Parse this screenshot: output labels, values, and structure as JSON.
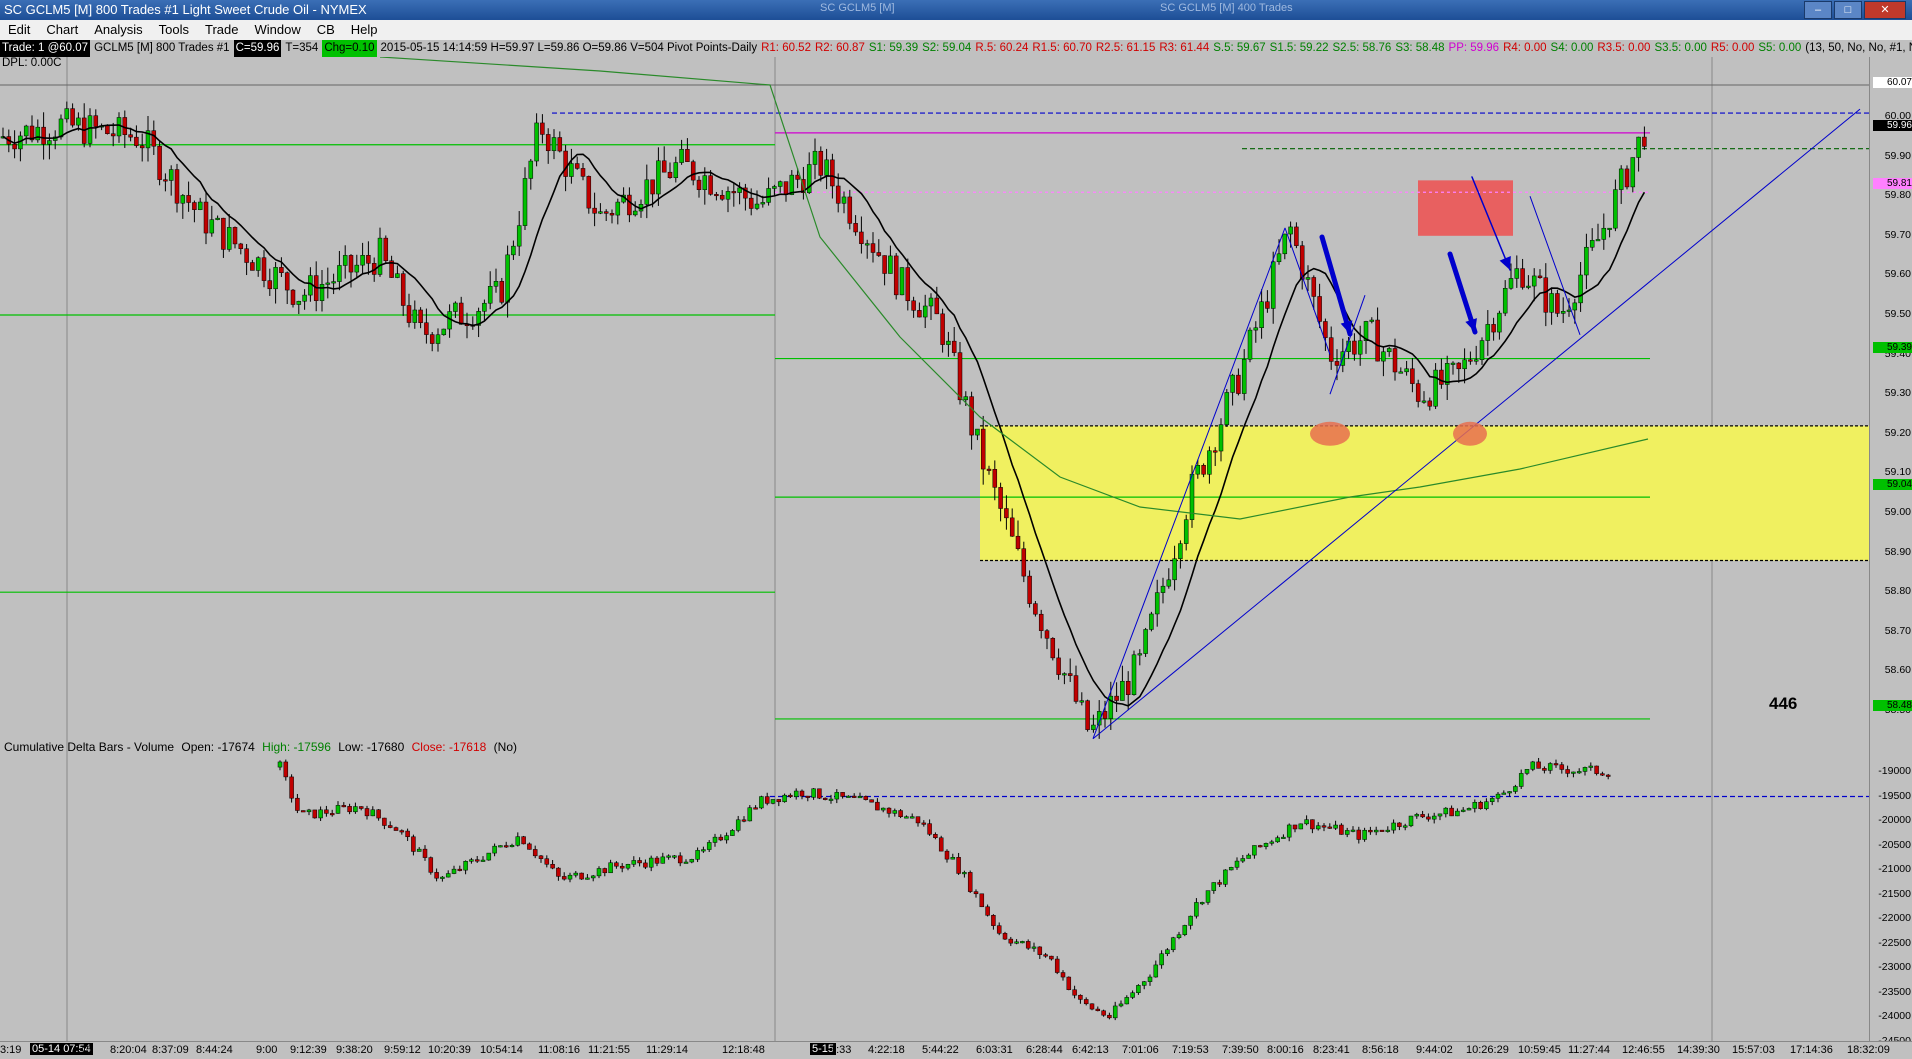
{
  "window": {
    "title": "SC GCLM5 [M]  800 Trades  #1  Light Sweet Crude Oil - NYMEX",
    "ghost_tabs": [
      "SC GCLM5 [M]",
      "SC GCLM5 [M] 400 Trades"
    ]
  },
  "menu": [
    "Edit",
    "Chart",
    "Analysis",
    "Tools",
    "Trade",
    "Window",
    "CB",
    "Help"
  ],
  "infobar": {
    "trade": "Trade: 1 @60.07",
    "symbol": "GCLM5 [M]  800 Trades  #1",
    "close": "C=59.96",
    "ticks": "T=354",
    "change": "Chg=0.10",
    "stats": "2015-05-15 14:14:59 H=59.97 L=59.86 O=59.86 V=504 Pivot Points-Daily",
    "pivots": [
      {
        "text": "R1: 60.52",
        "color": "red"
      },
      {
        "text": "R2: 60.87",
        "color": "red"
      },
      {
        "text": "S1: 59.39",
        "color": "green"
      },
      {
        "text": "S2: 59.04",
        "color": "green"
      },
      {
        "text": "R.5: 60.24",
        "color": "red"
      },
      {
        "text": "R1.5: 60.70",
        "color": "red"
      },
      {
        "text": "R2.5: 61.15",
        "color": "red"
      },
      {
        "text": "R3: 61.44",
        "color": "red"
      },
      {
        "text": "S.5: 59.67",
        "color": "green"
      },
      {
        "text": "S1.5: 59.22",
        "color": "green"
      },
      {
        "text": "S2.5: 58.76",
        "color": "green"
      },
      {
        "text": "S3: 58.48",
        "color": "green"
      },
      {
        "text": "PP: 59.96",
        "color": "magenta"
      },
      {
        "text": "R4: 0.00",
        "color": "red"
      },
      {
        "text": "S4: 0.00",
        "color": "green"
      },
      {
        "text": "R3.5: 0.00",
        "color": "red"
      },
      {
        "text": "S3.5: 0.00",
        "color": "green"
      },
      {
        "text": "R5: 0.00",
        "color": "red"
      },
      {
        "text": "S5: 0.00",
        "color": "green"
      },
      {
        "text": "(13, 50, No, No, #1, N",
        "color": "black"
      }
    ],
    "dpl": "DPL: 0.00C"
  },
  "price_axis": {
    "labels": [
      "60.00",
      "59.90",
      "59.80",
      "59.70",
      "59.60",
      "59.50",
      "59.40",
      "59.30",
      "59.20",
      "59.10",
      "59.00",
      "58.90",
      "58.80",
      "58.70",
      "58.60",
      "58.50"
    ],
    "tags": [
      {
        "text": "60.07",
        "bg": "#ffffff",
        "fg": "#000000"
      },
      {
        "text": "59.96",
        "bg": "#000000",
        "fg": "#ffffff"
      },
      {
        "text": "59.81",
        "bg": "#ff80ff",
        "fg": "#ff80ff"
      },
      {
        "text": "59.39",
        "bg": "#00c000",
        "fg": "#00c000"
      },
      {
        "text": "59.04",
        "bg": "#00c000",
        "fg": "#00c000"
      },
      {
        "text": "58.48",
        "bg": "#00c000",
        "fg": "#00c000"
      }
    ]
  },
  "delta_axis": {
    "labels": [
      "-19000",
      "-19500",
      "-20000",
      "-20500",
      "-21000",
      "-21500",
      "-22000",
      "-22500",
      "-23000",
      "-23500",
      "-24000",
      "-24500"
    ]
  },
  "study": {
    "name": "Cumulative Delta Bars - Volume",
    "open": "Open: -17674",
    "high": "High: -17596",
    "low": "Low: -17680",
    "close": "Close: -17618",
    "flag": "(No)"
  },
  "time_axis": {
    "start_tag": "05-14  07:54",
    "mid_tag": "5-15",
    "ticks": [
      "3:19",
      "43",
      "8:20:04",
      "8:37:09",
      "8:44:24",
      "9:00",
      "9:12:39",
      "9:38:20",
      "9:59:12",
      "10:20:39",
      "10:54:14",
      "11:08:16",
      "11:21:55",
      "11:29:14",
      "12:18:48",
      "1:33",
      "4:22:18",
      "5:44:22",
      "6:03:31",
      "6:28:44",
      "6:42:13",
      "7:01:06",
      "7:19:53",
      "7:39:50",
      "8:00:16",
      "8:23:41",
      "8:56:18",
      "9:44:02",
      "10:26:29",
      "10:59:45",
      "11:27:44",
      "12:46:55",
      "14:39:30",
      "15:57:03",
      "17:14:36",
      "18:32:09"
    ]
  },
  "annotations": {
    "counter": "446"
  },
  "colors": {
    "up_candle": "#00c000",
    "down_candle": "#c00000",
    "zone_yellow": "#f0f060",
    "zone_red": "#e86060",
    "arrow_blue": "#0000cc"
  }
}
